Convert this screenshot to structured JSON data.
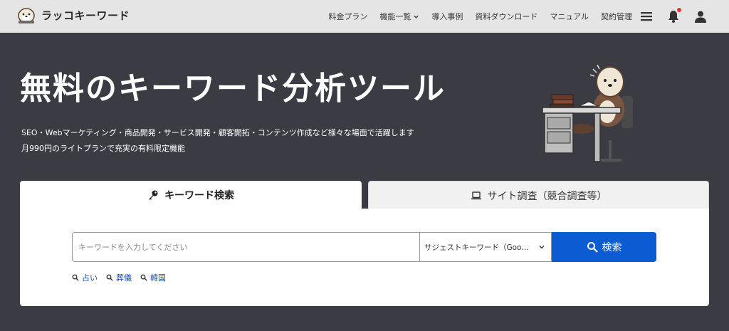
{
  "header": {
    "logo_text": "ラッコキーワード",
    "nav": [
      {
        "label": "料金プラン"
      },
      {
        "label": "機能一覧",
        "has_dropdown": true
      },
      {
        "label": "導入事例"
      },
      {
        "label": "資料ダウンロード"
      },
      {
        "label": "マニュアル"
      },
      {
        "label": "契約管理"
      }
    ],
    "icons": [
      "menu-icon",
      "bell-icon",
      "user-icon"
    ],
    "notification_dot": true
  },
  "hero": {
    "title": "無料のキーワード分析ツール",
    "subtitle_line1": "SEO・Webマーケティング・商品開発・サービス開発・顧客開拓・コンテンツ作成など様々な場面で活躍します",
    "subtitle_line2": "月990円のライトプランで充実の有料限定機能"
  },
  "tabs": [
    {
      "label": "キーワード検索",
      "icon": "key-icon",
      "active": true
    },
    {
      "label": "サイト調査（競合調査等）",
      "icon": "laptop-icon",
      "active": false
    }
  ],
  "search": {
    "placeholder": "キーワードを入力してください",
    "value": "",
    "mode_selected": "サジェストキーワード（Google）",
    "button_label": "検索"
  },
  "suggestions": [
    "占い",
    "葬儀",
    "韓国"
  ],
  "colors": {
    "background": "#3a3b43",
    "header_bg": "#e5e5e5",
    "accent": "#0b5bd3",
    "link": "#1d4fa8",
    "badge": "#e53935"
  }
}
